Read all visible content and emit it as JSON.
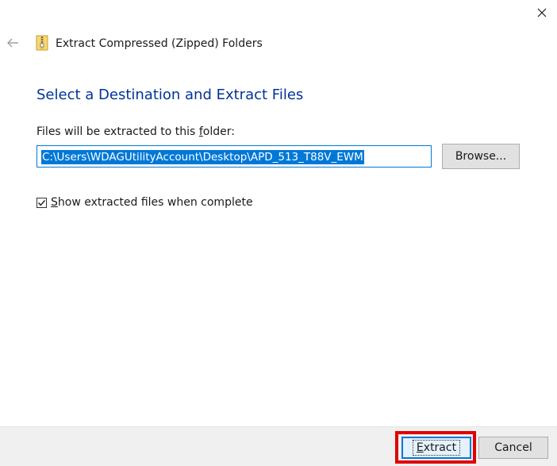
{
  "window": {
    "title": "Extract Compressed (Zipped) Folders"
  },
  "icons": {
    "close": "close-icon",
    "back": "back-arrow-icon",
    "app": "zip-folder-icon",
    "check": "checkmark-icon"
  },
  "main": {
    "heading": "Select a Destination and Extract Files",
    "folder_label_pre": "Files will be extracted to this ",
    "folder_label_key": "f",
    "folder_label_post": "older:",
    "path_value": "C:\\Users\\WDAGUtilityAccount\\Desktop\\APD_513_T88V_EWM",
    "browse_label": "Browse...",
    "show_files": {
      "checked": true,
      "label_key": "S",
      "label_rest": "how extracted files when complete"
    }
  },
  "footer": {
    "extract_key": "E",
    "extract_rest": "xtract",
    "cancel_label": "Cancel"
  },
  "colors": {
    "heading": "#003399",
    "accent": "#0078d7",
    "highlight": "#e00000",
    "footer_bg": "#f0f0f0"
  }
}
